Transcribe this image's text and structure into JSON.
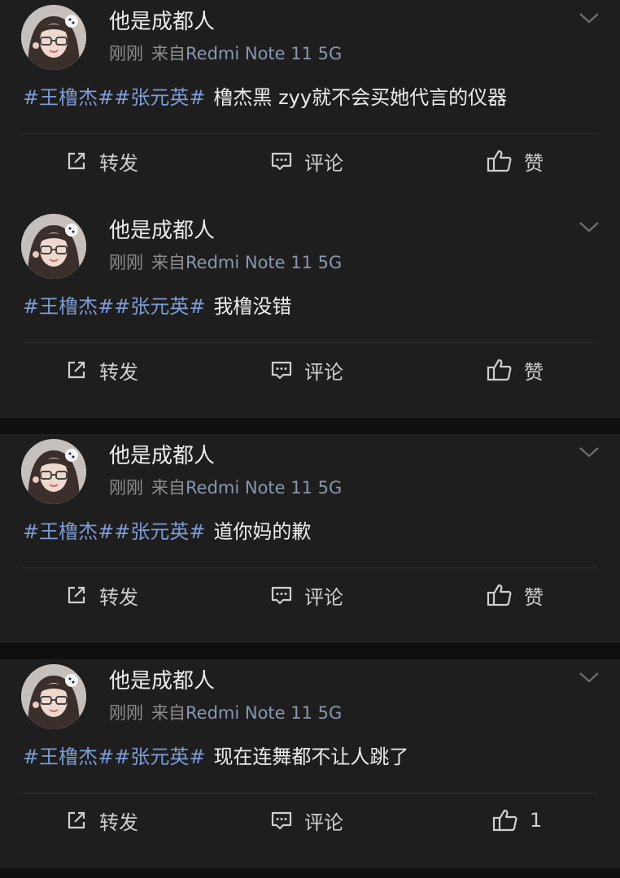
{
  "posts": [
    {
      "username": "他是成都人",
      "time": "刚刚",
      "source_prefix": "来自",
      "device": "Redmi Note 11 5G",
      "tags": "#王橹杰##张元英#",
      "text": "橹杰黑 zyy就不会买她代言的仪器",
      "actions": {
        "forward": "转发",
        "comment": "评论",
        "like": "赞"
      }
    },
    {
      "username": "他是成都人",
      "time": "刚刚",
      "source_prefix": "来自",
      "device": "Redmi Note 11 5G",
      "tags": "#王橹杰##张元英#",
      "text": "我橹没错",
      "actions": {
        "forward": "转发",
        "comment": "评论",
        "like": "赞"
      }
    },
    {
      "username": "他是成都人",
      "time": "刚刚",
      "source_prefix": "来自",
      "device": "Redmi Note 11 5G",
      "tags": "#王橹杰##张元英#",
      "text": "道你妈的歉",
      "actions": {
        "forward": "转发",
        "comment": "评论",
        "like": "赞"
      }
    },
    {
      "username": "他是成都人",
      "time": "刚刚",
      "source_prefix": "来自",
      "device": "Redmi Note 11 5G",
      "tags": "#王橹杰##张元英#",
      "text": "现在连舞都不让人跳了",
      "actions": {
        "forward": "转发",
        "comment": "评论",
        "like": "1"
      }
    }
  ],
  "icons": {
    "forward": "share-arrow-icon",
    "comment": "comment-bubble-icon",
    "like": "thumbs-up-icon",
    "menu": "chevron-down-icon"
  },
  "colors": {
    "page_background": "#0f0f0f",
    "card_background": "#1e1e1e",
    "topic_link": "#7d9cd6",
    "device_text": "#8a96b0",
    "meta_text": "#8c8c8c"
  }
}
